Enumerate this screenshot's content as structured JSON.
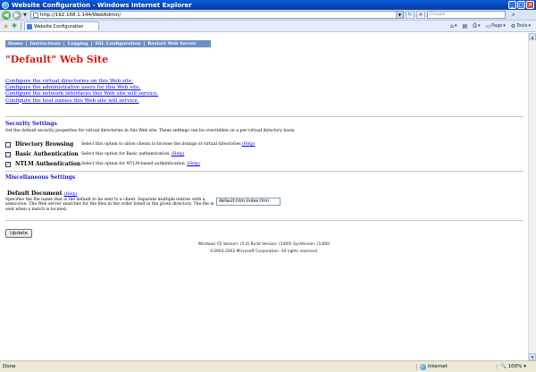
{
  "browser": {
    "window_title": "Website Configuration - Windows Internet Explorer",
    "address_url": "http://192.168.1.144/WebAdmin/",
    "search_placeholder": "Google",
    "tab_title": "Website Configuration",
    "cmd_page": "Page",
    "cmd_tools": "Tools",
    "status_text": "Done",
    "zone_label": "Internet",
    "zoom_label": "100%"
  },
  "nav": {
    "items": [
      "Home",
      "Instructions",
      "Logging",
      "SSL Configuration",
      "Restart Web Server"
    ]
  },
  "site": {
    "title": "\"Default\" Web Site"
  },
  "links": [
    "Configure the virtual directories on this Web site.",
    "Configure the administrative users for this Web site.",
    "Configure the network interfaces this Web site will service.",
    "Configure the host names this Web site will service."
  ],
  "security": {
    "title": "Security Settings",
    "description": "Set the default security properties for virtual directories in this Web site. These settings can be overridden on a per-virtual directory basis.",
    "settings": [
      {
        "label": "Directory Browsing",
        "checked": false,
        "description": "Select this option to allow clients to browse the listings of virtual directories",
        "help": "(Help)"
      },
      {
        "label": "Basic Authentication",
        "checked": false,
        "description": "Select this option for Basic authentication.",
        "help": "(Help)"
      },
      {
        "label": "NTLM Authentication",
        "checked": true,
        "description": "Select this option for NTLM-based authentication.",
        "help": "(Help)"
      }
    ]
  },
  "misc": {
    "title": "Miscellaneous Settings",
    "default_document_label": "Default Document",
    "default_document_help": "(Help)",
    "default_document_description": "Specifies the file name that is the default to be sent to a client. Separate multiple entries with a semicolon. The Web server searches for the files in the order listed in the given directory. The file is sent when a match is located.",
    "default_document_value": "default.htm;index.htm"
  },
  "update_button": "Update",
  "footer": {
    "version": "Windows CE Version: (5.0) Build Version: (1400) SysVersion: (1400)",
    "copyright": "©2003-2002 Microsoft Corporation. All rights reserved."
  }
}
